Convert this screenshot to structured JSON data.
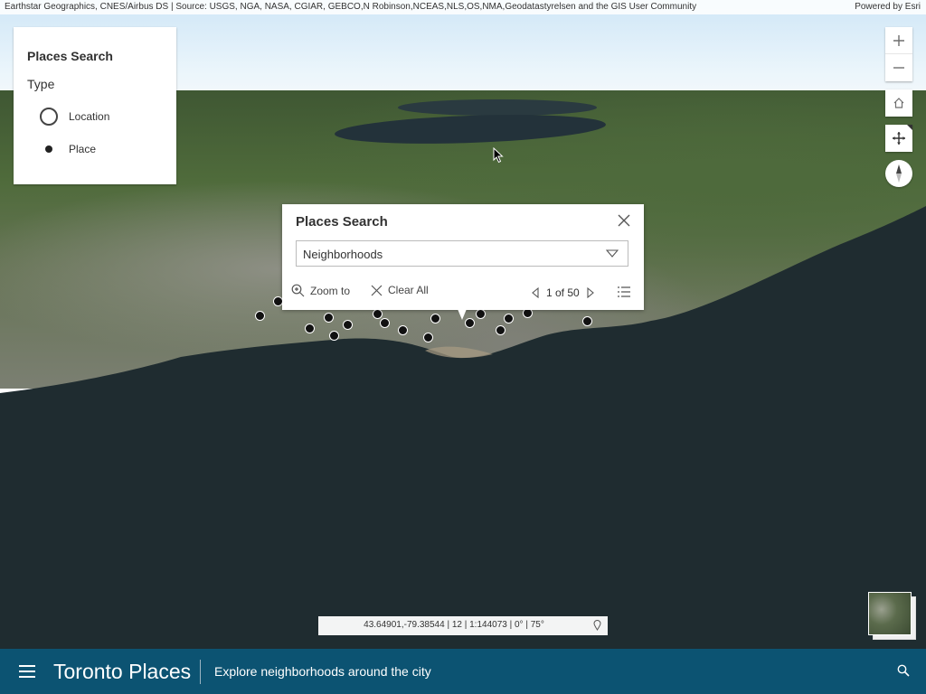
{
  "attribution": {
    "sources": "Earthstar Geographics, CNES/Airbus DS | Source: USGS, NGA, NASA, CGIAR, GEBCO,N Robinson,NCEAS,NLS,OS,NMA,Geodatastyrelsen and the GIS User Community",
    "powered_by": "Powered by Esri"
  },
  "type_panel": {
    "title": "Places Search",
    "label": "Type",
    "options": [
      {
        "label": "Location",
        "icon": "open-circle-icon"
      },
      {
        "label": "Place",
        "icon": "filled-dot-icon"
      }
    ]
  },
  "nav": {
    "zoom_in": "+",
    "zoom_out": "−",
    "icons": [
      "plus-icon",
      "minus-icon",
      "home-icon",
      "pan-icon",
      "compass-icon"
    ]
  },
  "popup": {
    "title": "Places Search",
    "selected": "Neighborhoods",
    "zoom_to": "Zoom to",
    "clear_all": "Clear All",
    "pager": "1 of 50"
  },
  "coords": {
    "text": "43.64901,-79.38544 | 12 | 1:144073 | 0° | 75°"
  },
  "header": {
    "title": "Toronto Places",
    "subtitle": "Explore neighborhoods around the city"
  },
  "colors": {
    "header_bg": "#0c5372",
    "water": "#1f2c30"
  }
}
